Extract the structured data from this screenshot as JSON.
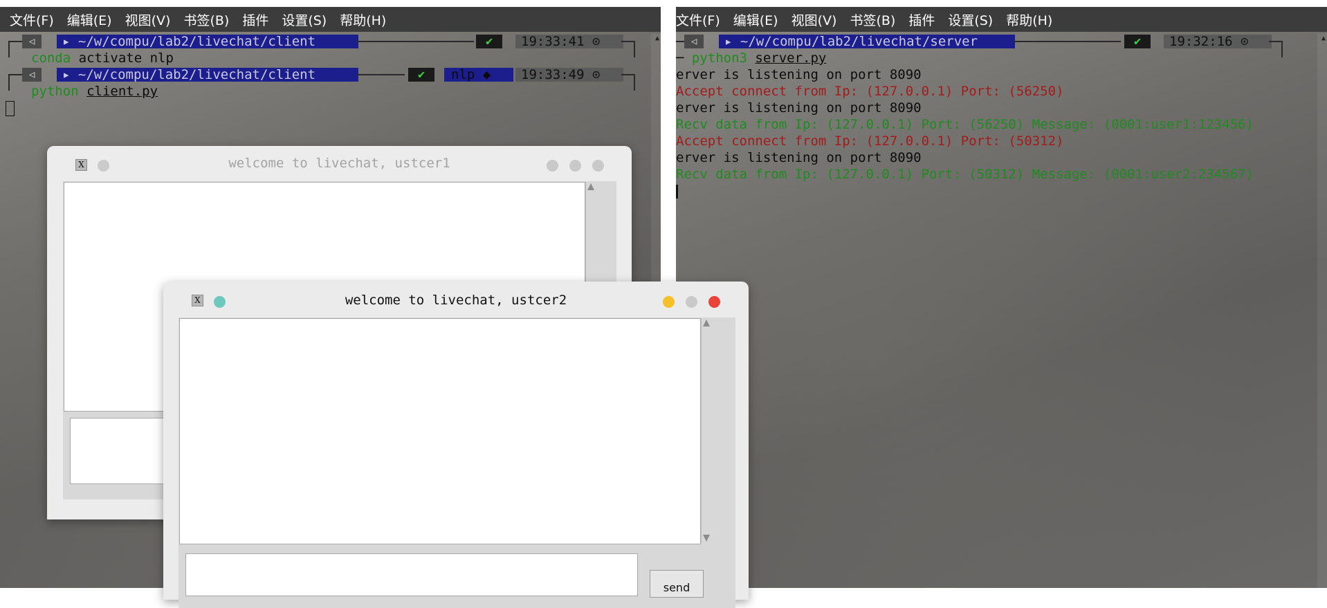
{
  "menu": [
    "文件(F)",
    "编辑(E)",
    "视图(V)",
    "书签(B)",
    "插件",
    "设置(S)",
    "帮助(H)"
  ],
  "client_terminal": {
    "prompt1": {
      "icon": "◁",
      "path": "▸ ~/w/compu/lab2/livechat/client",
      "status": "✔",
      "time": "19:33:41 ⊙"
    },
    "cmd1": {
      "bin": "conda",
      "args": " activate nlp"
    },
    "prompt2": {
      "icon": "◁",
      "path": "▸ ~/w/compu/lab2/livechat/client",
      "status": "✔",
      "env": "nlp ◆",
      "time": "19:33:49 ⊙"
    },
    "cmd2": {
      "bin": "python",
      "args": "client.py"
    }
  },
  "server_terminal": {
    "prompt": {
      "icon": "◁",
      "path": "▸ ~/w/compu/lab2/livechat/server",
      "status": "✔",
      "time": "19:32:16 ⊙"
    },
    "cmd": {
      "prefix": "─ ",
      "bin": "python3",
      "args": "server.py"
    },
    "log": [
      {
        "text": "erver is listening on port 8090",
        "color": "#0c0c0c"
      },
      {
        "text": "Accept connect from Ip: (127.0.0.1) Port: (56250)",
        "color": "#a21c1c"
      },
      {
        "text": "erver is listening on port 8090",
        "color": "#0c0c0c"
      },
      {
        "text": "Recv data from Ip: (127.0.0.1) Port: (56250) Message: (0001:user1:123456)",
        "color": "#1e8c1e"
      },
      {
        "text": "Accept connect from Ip: (127.0.0.1) Port: (50312)",
        "color": "#a21c1c"
      },
      {
        "text": "erver is listening on port 8090",
        "color": "#0c0c0c"
      },
      {
        "text": "Recv data from Ip: (127.0.0.1) Port: (50312) Message: (0001:user2:234567)",
        "color": "#1e8c1e"
      }
    ]
  },
  "chat_window_1": {
    "title": "welcome to livechat, ustcer1",
    "app_icon": "X"
  },
  "chat_window_2": {
    "title": "welcome to livechat, ustcer2",
    "app_icon": "X",
    "send_label": "send"
  }
}
